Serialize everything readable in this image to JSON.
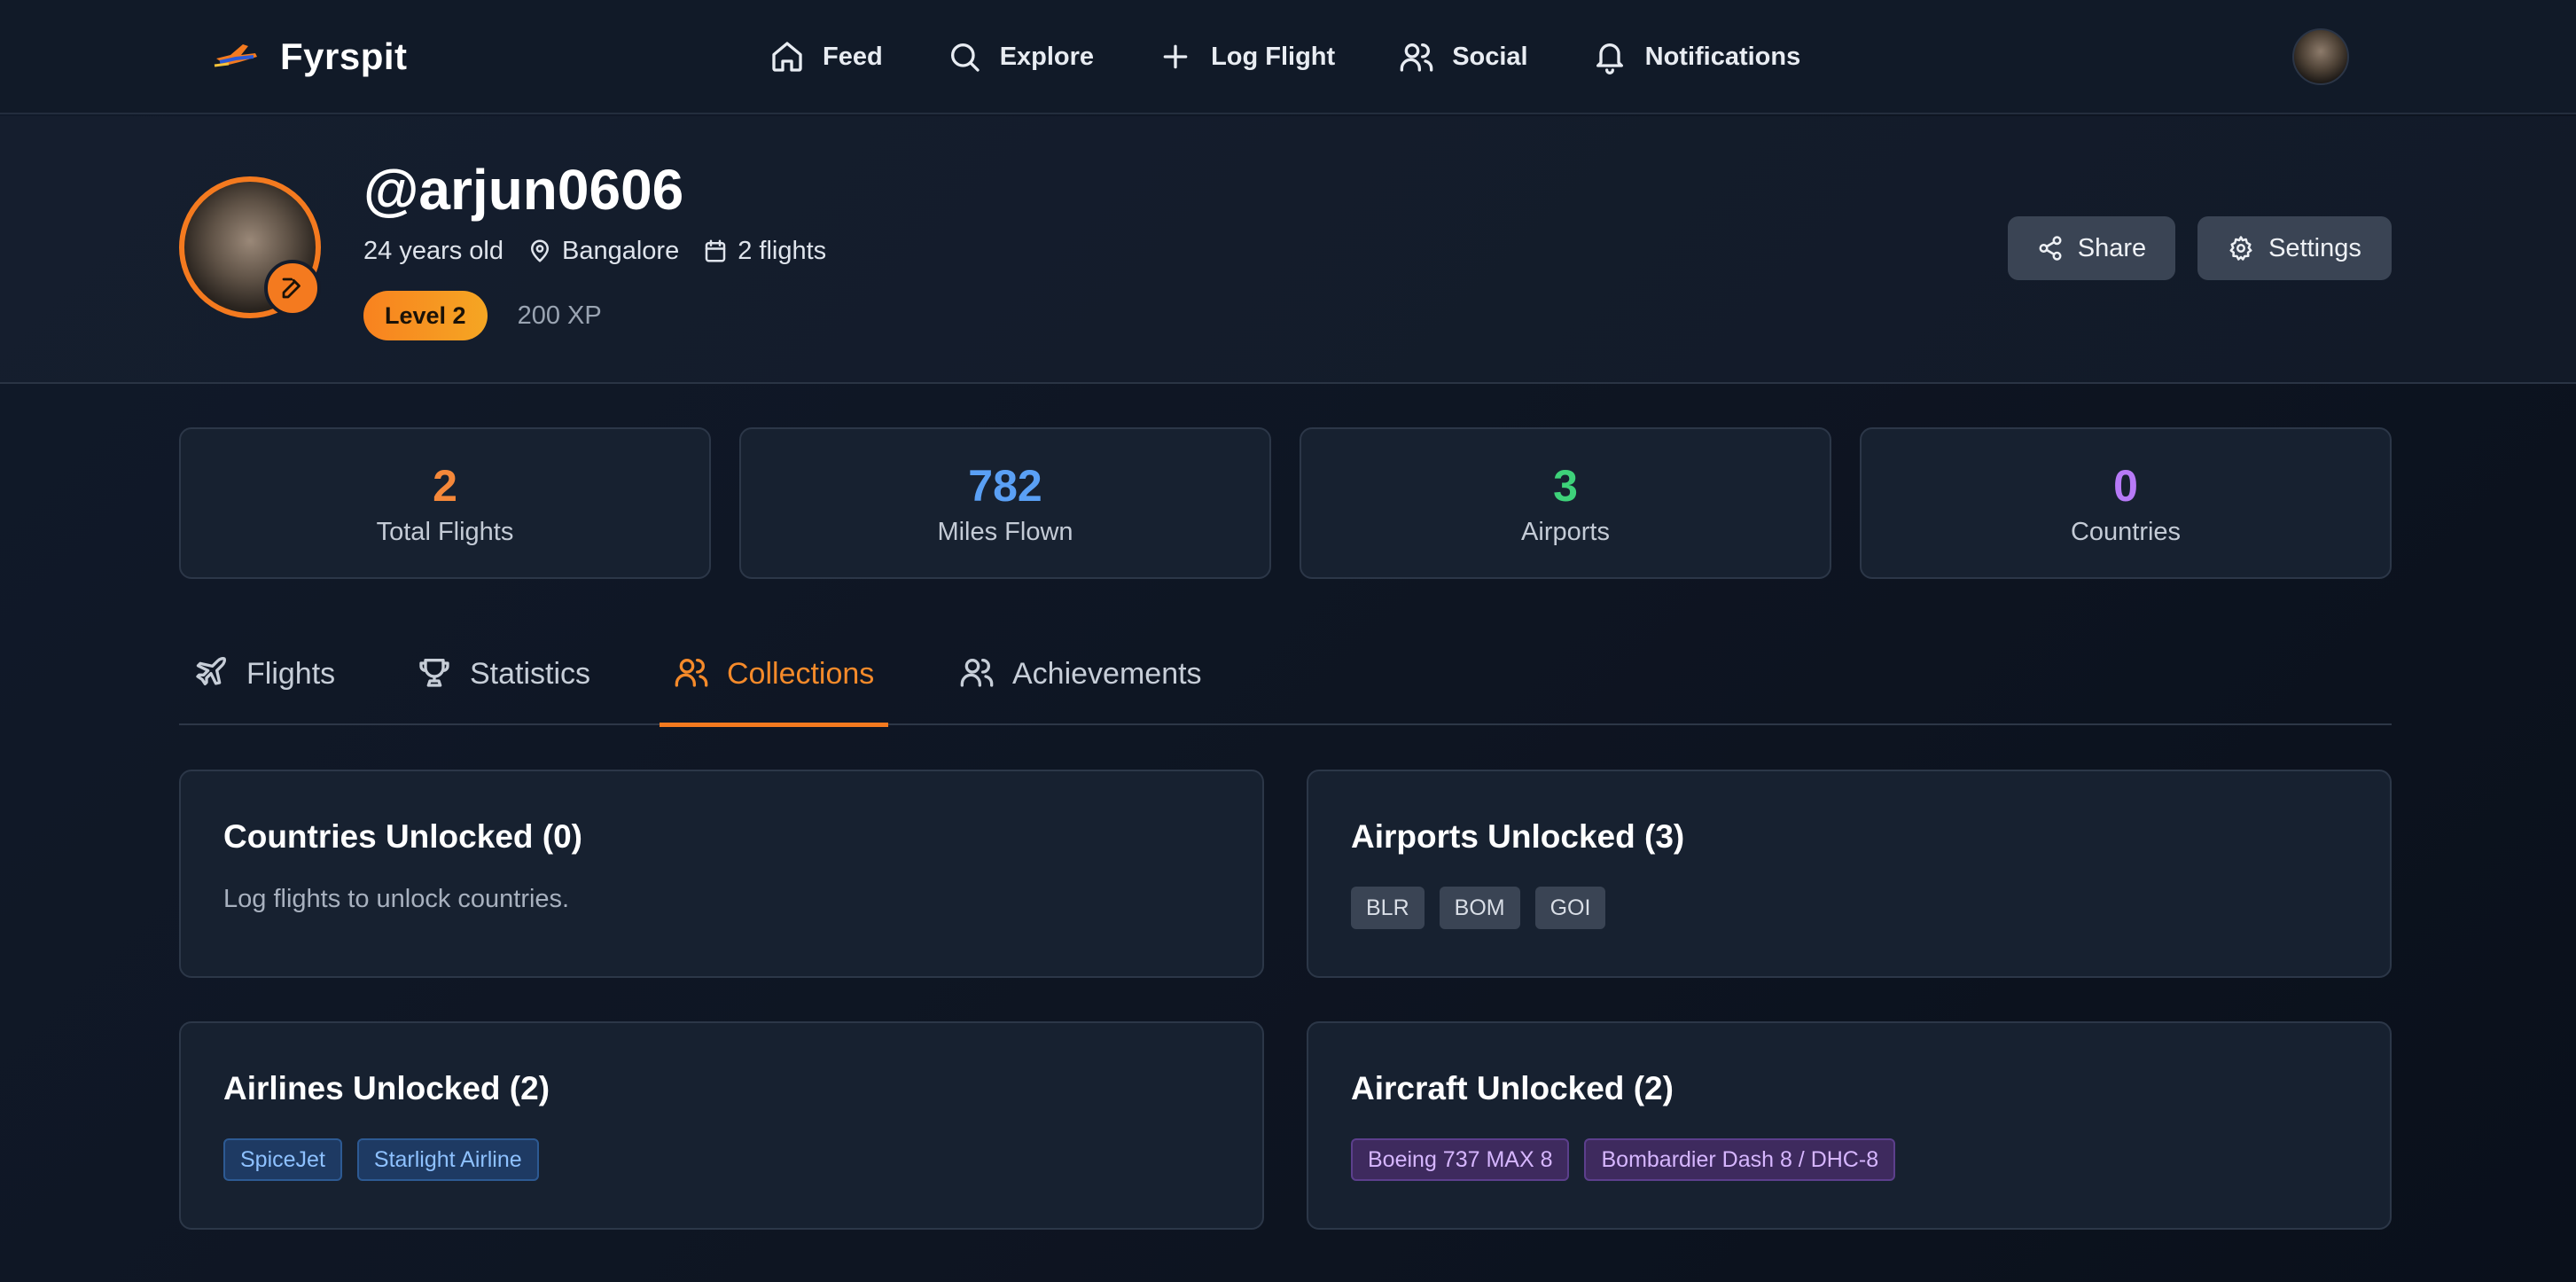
{
  "app": {
    "name": "Fyrspit"
  },
  "nav": {
    "items": [
      {
        "label": "Feed",
        "icon": "home-icon"
      },
      {
        "label": "Explore",
        "icon": "search-icon"
      },
      {
        "label": "Log Flight",
        "icon": "plus-icon"
      },
      {
        "label": "Social",
        "icon": "users-icon"
      },
      {
        "label": "Notifications",
        "icon": "bell-icon"
      }
    ]
  },
  "profile": {
    "username": "@arjun0606",
    "age": "24 years old",
    "location": "Bangalore",
    "flights": "2 flights",
    "level": "Level 2",
    "xp": "200 XP",
    "share_label": "Share",
    "settings_label": "Settings"
  },
  "stats": [
    {
      "value": "2",
      "label": "Total Flights",
      "color": "#f5883a"
    },
    {
      "value": "782",
      "label": "Miles Flown",
      "color": "#5aa0f5"
    },
    {
      "value": "3",
      "label": "Airports",
      "color": "#3ed27a"
    },
    {
      "value": "0",
      "label": "Countries",
      "color": "#b77af7"
    }
  ],
  "tabs": [
    {
      "label": "Flights",
      "icon": "plane-icon"
    },
    {
      "label": "Statistics",
      "icon": "trophy-icon"
    },
    {
      "label": "Collections",
      "icon": "users-icon",
      "active": true
    },
    {
      "label": "Achievements",
      "icon": "users-icon"
    }
  ],
  "collections": {
    "countries": {
      "title": "Countries Unlocked (0)",
      "empty": "Log flights to unlock countries."
    },
    "airports": {
      "title": "Airports Unlocked (3)",
      "items": [
        "BLR",
        "BOM",
        "GOI"
      ]
    },
    "airlines": {
      "title": "Airlines Unlocked (2)",
      "items": [
        "SpiceJet",
        "Starlight Airline"
      ]
    },
    "aircraft": {
      "title": "Aircraft Unlocked (2)",
      "items": [
        "Boeing 737 MAX 8",
        "Bombardier Dash 8 / DHC-8"
      ]
    }
  },
  "colors": {
    "accent": "#f47a1f",
    "background": "#0f1624",
    "card": "#172130"
  }
}
